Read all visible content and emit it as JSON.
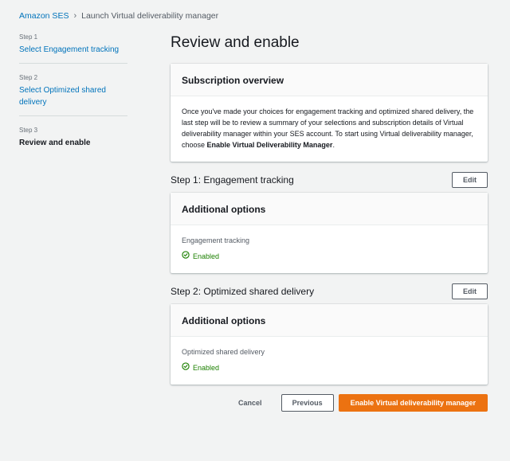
{
  "breadcrumb": {
    "root": "Amazon SES",
    "current": "Launch Virtual deliverability manager"
  },
  "wizard": {
    "steps": [
      {
        "number": "Step 1",
        "label": "Select Engagement tracking"
      },
      {
        "number": "Step 2",
        "label": "Select Optimized shared delivery"
      },
      {
        "number": "Step 3",
        "label": "Review and enable"
      }
    ]
  },
  "page": {
    "title": "Review and enable"
  },
  "overview": {
    "title": "Subscription overview",
    "text_before": "Once you've made your choices for engagement tracking and optimized shared delivery, the last step will be to review a summary of your selections and subscription details of Virtual deliverability manager within your SES account. To start using Virtual deliverability manager, choose ",
    "text_bold": "Enable Virtual Deliverability Manager",
    "text_after": "."
  },
  "section1": {
    "title": "Step 1: Engagement tracking",
    "edit_label": "Edit",
    "card_title": "Additional options",
    "field_label": "Engagement tracking",
    "status": "Enabled"
  },
  "section2": {
    "title": "Step 2: Optimized shared delivery",
    "edit_label": "Edit",
    "card_title": "Additional options",
    "field_label": "Optimized shared delivery",
    "status": "Enabled"
  },
  "actions": {
    "cancel": "Cancel",
    "previous": "Previous",
    "primary": "Enable Virtual deliverability manager"
  },
  "colors": {
    "link": "#0073bb",
    "success": "#1d8102",
    "primary": "#ec7211"
  },
  "icons": {
    "separator": "chevron-right-icon",
    "status": "check-circle-icon"
  }
}
